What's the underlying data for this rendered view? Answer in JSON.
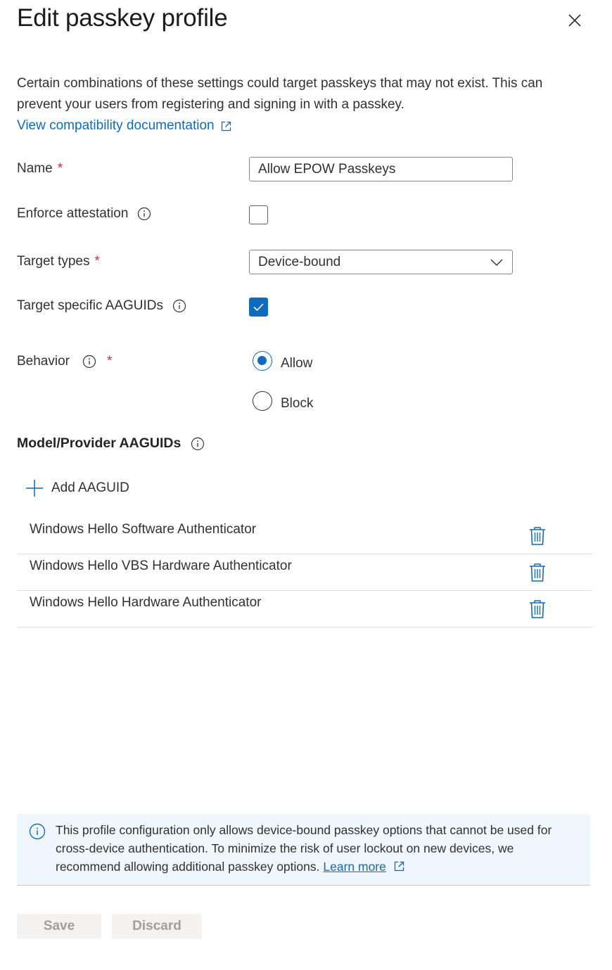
{
  "panel": {
    "title": "Edit passkey profile"
  },
  "intro": {
    "text": "Certain combinations of these settings could target passkeys that may not exist. This can prevent your users from registering and signing in with a passkey.",
    "doc_link": "View compatibility documentation"
  },
  "form": {
    "name_label": "Name",
    "name_value": "Allow EPOW Passkeys",
    "required_mark": "*",
    "enforce_attestation_label": "Enforce attestation",
    "enforce_attestation_checked": false,
    "target_types_label": "Target types",
    "target_types_value": "Device-bound",
    "target_specific_label": "Target specific AAGUIDs",
    "target_specific_checked": true,
    "behavior_label": "Behavior",
    "behavior_options": [
      "Allow",
      "Block"
    ],
    "behavior_selected": "Allow"
  },
  "aaguids": {
    "title": "Model/Provider AAGUIDs",
    "add_label": "Add AAGUID",
    "items": [
      "Windows Hello Software Authenticator",
      "Windows Hello VBS Hardware Authenticator",
      "Windows Hello Hardware Authenticator"
    ]
  },
  "info_bar": {
    "text": "This profile configuration only allows device-bound passkey options that cannot be used for cross-device authentication. To minimize the risk of user lockout on new devices, we recommend allowing additional passkey options.",
    "learn_more": "Learn more"
  },
  "footer": {
    "save_label": "Save",
    "discard_label": "Discard"
  },
  "colors": {
    "accent": "#0f6cbd",
    "required": "#c4314b",
    "info_bg": "#eff6fc"
  }
}
